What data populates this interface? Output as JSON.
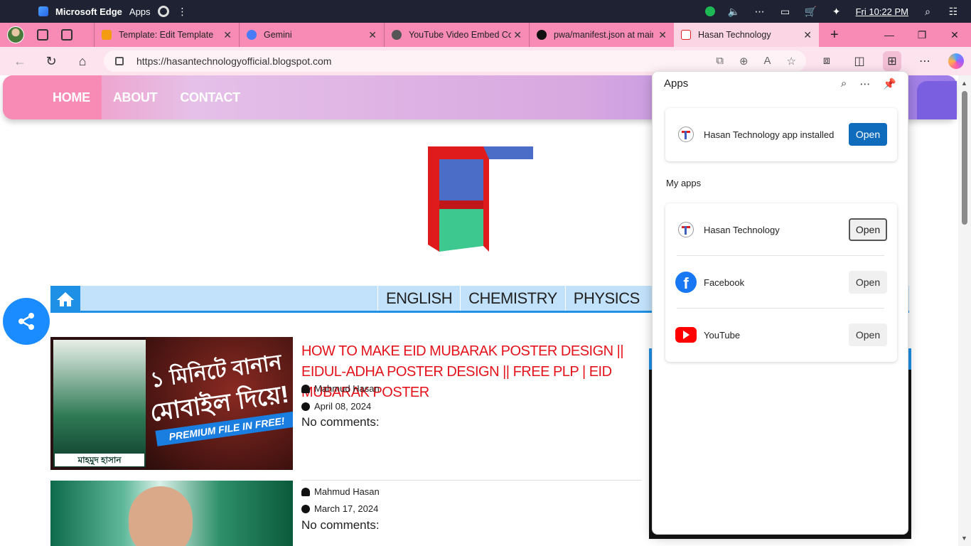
{
  "os": {
    "browser_name": "Microsoft Edge",
    "apps_label": "Apps",
    "clock": "Fri 10:22 PM"
  },
  "tabs": [
    {
      "title": "Template: Edit Template",
      "favicon_color": "#f39c12"
    },
    {
      "title": "Gemini",
      "favicon_color": "#4a7bf7"
    },
    {
      "title": "YouTube Video Embed Coc",
      "favicon_color": "#555555"
    },
    {
      "title": "pwa/manifest.json at main",
      "favicon_color": "#111111"
    },
    {
      "title": "Hasan Technology",
      "favicon_color": "#d22222",
      "active": true
    }
  ],
  "address": {
    "url": "https://hasantechnologyofficial.blogspot.com"
  },
  "site": {
    "menu": [
      "HOME",
      "ABOUT",
      "CONTACT"
    ],
    "categories": [
      "ENGLISH",
      "CHEMISTRY",
      "PHYSICS"
    ],
    "posts": [
      {
        "title": "HOW TO MAKE EID MUBARAK POSTER DESIGN || EIDUL-ADHA POSTER DESIGN || FREE PLP | EID MUBARAK POSTER",
        "author": "Mahmud Hasan",
        "date": "April 08, 2024",
        "comments": "No comments:",
        "thumb_text_1": "১ মিনিটে বানান",
        "thumb_text_2": "মোবাইল দিয়ে!",
        "thumb_ribbon": "PREMIUM FILE IN FREE!",
        "thumb_name": "মাহমুদ হাসান"
      },
      {
        "author": "Mahmud Hasan",
        "date": "March 17, 2024",
        "comments": "No comments:"
      }
    ]
  },
  "apps_flyout": {
    "title": "Apps",
    "installed": {
      "name": "Hasan Technology app installed",
      "button": "Open"
    },
    "my_apps_label": "My apps",
    "my_apps": [
      {
        "name": "Hasan Technology",
        "button": "Open",
        "icon": "hasan-technology-icon"
      },
      {
        "name": "Facebook",
        "button": "Open",
        "icon": "facebook-icon"
      },
      {
        "name": "YouTube",
        "button": "Open",
        "icon": "youtube-icon"
      }
    ]
  },
  "colors": {
    "tab_strip": "#f78bb5",
    "primary_button": "#0f6cbd",
    "post_title": "#e3121b",
    "category_accent": "#1e90e6"
  }
}
